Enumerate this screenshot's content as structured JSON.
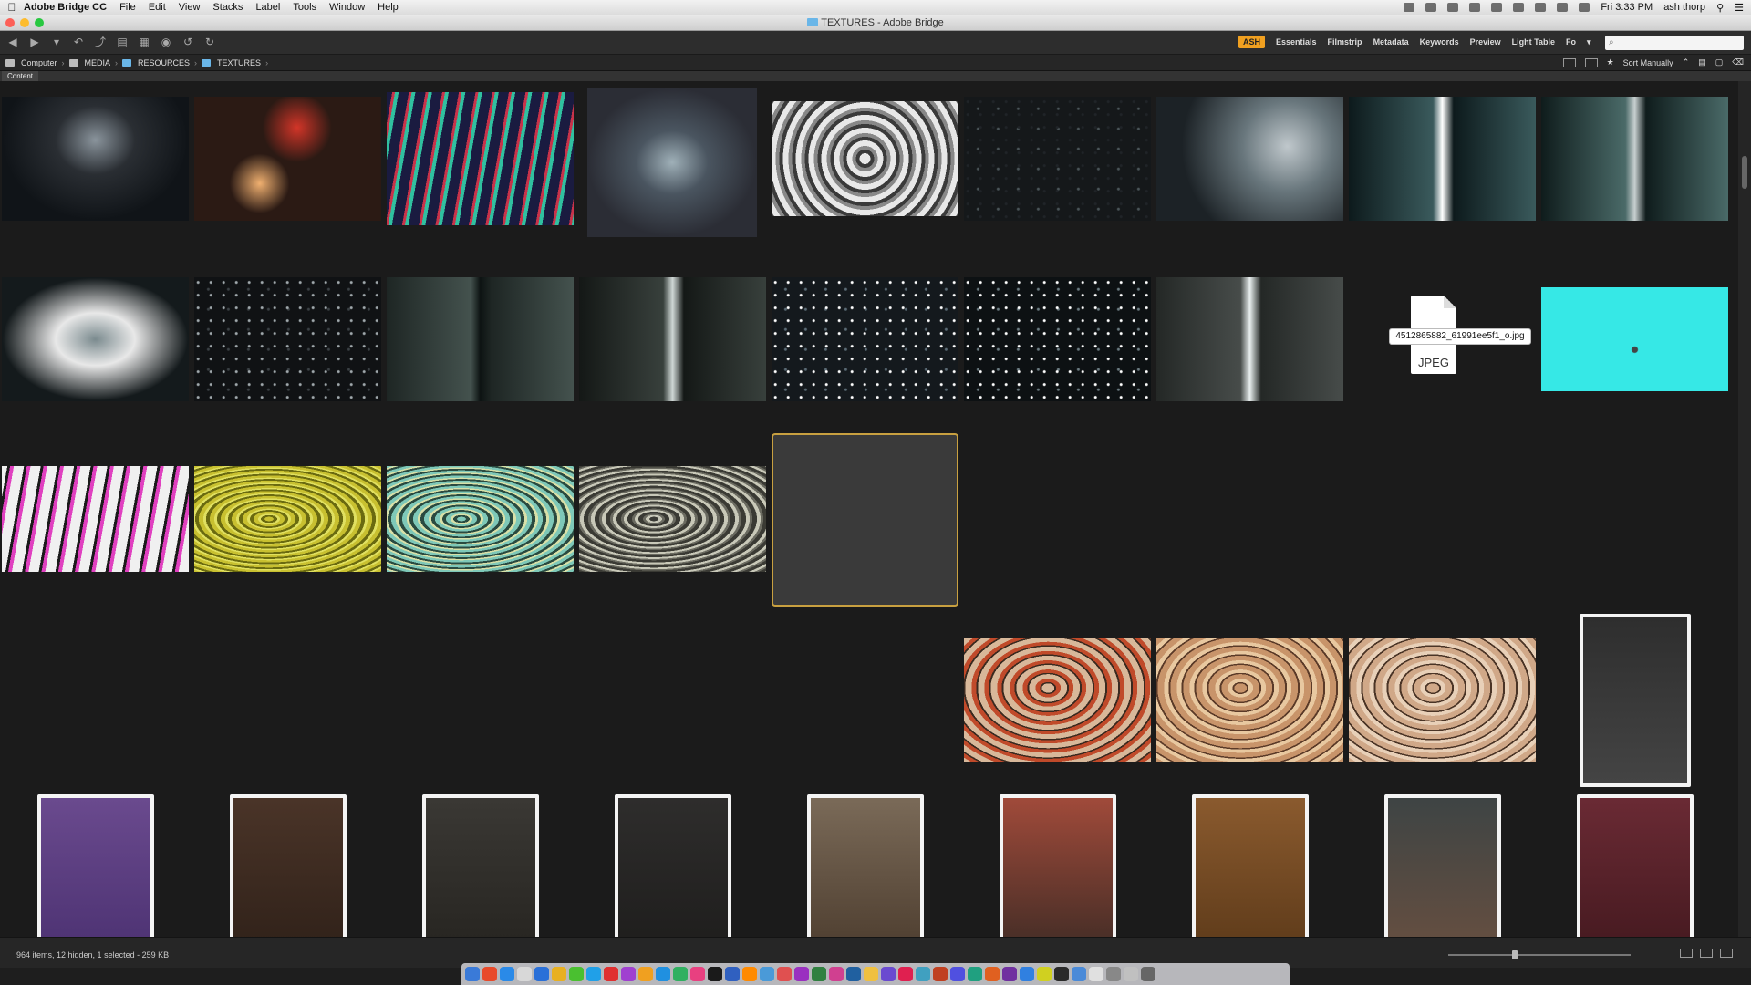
{
  "menubar": {
    "app_name": "Adobe Bridge CC",
    "items": [
      "File",
      "Edit",
      "View",
      "Stacks",
      "Label",
      "Tools",
      "Window",
      "Help"
    ],
    "clock": "Fri 3:33 PM",
    "user": "ash thorp"
  },
  "window": {
    "title": "TEXTURES - Adobe Bridge"
  },
  "toolbar": {
    "workspaces": [
      "ASH",
      "Essentials",
      "Filmstrip",
      "Metadata",
      "Keywords",
      "Preview",
      "Light Table",
      "Fo"
    ],
    "active_workspace": "ASH",
    "search_placeholder": "⌕"
  },
  "pathbar": {
    "crumbs": [
      "Computer",
      "MEDIA",
      "RESOURCES",
      "TEXTURES"
    ],
    "sort_label": "Sort Manually"
  },
  "panel": {
    "tab": "Content"
  },
  "file_tooltip": {
    "filename": "4512865882_61991ee5f1_o.jpg",
    "ext": "JPEG"
  },
  "status": {
    "text": "964 items, 12 hidden, 1 selected - 259 KB"
  },
  "thumbnails": [
    {
      "colors": [
        "#101418",
        "#8a949c",
        "#2a2e33"
      ],
      "kind": "corridor"
    },
    {
      "colors": [
        "#2b1a14",
        "#d23528",
        "#f0b070"
      ],
      "kind": "warm-blur"
    },
    {
      "colors": [
        "#1a1b40",
        "#c8334a",
        "#30c0a0"
      ],
      "kind": "glitch"
    },
    {
      "colors": [
        "#2b2d35",
        "#9fb0b8",
        "#4a5560"
      ],
      "kind": "glass"
    },
    {
      "colors": [
        "#e8e8e8",
        "#3a3a3a",
        "#888888"
      ],
      "kind": "spiral"
    },
    {
      "colors": [
        "#15181a",
        "#4a5458",
        "#202428"
      ],
      "kind": "dust"
    },
    {
      "colors": [
        "#1c2226",
        "#68767c",
        "#c0c8cc"
      ],
      "kind": "drops"
    },
    {
      "colors": [
        "#0d1a1c",
        "#3a5a5c",
        "#ffffff"
      ],
      "kind": "streak"
    },
    {
      "colors": [
        "#0f1c1c",
        "#4a6a68",
        "#c8d0d0"
      ],
      "kind": "streak"
    },
    {
      "colors": [
        "#141a1c",
        "#7a8a8e",
        "#e8e8e8"
      ],
      "kind": "glass"
    },
    {
      "colors": [
        "#101214",
        "#3a4044",
        "#a0a8ac"
      ],
      "kind": "dust"
    },
    {
      "colors": [
        "#1e2624",
        "#44524e",
        "#0d1312"
      ],
      "kind": "streak"
    },
    {
      "colors": [
        "#141816",
        "#38403c",
        "#d0d8d6"
      ],
      "kind": "streak"
    },
    {
      "colors": [
        "#14191d",
        "#5a6a74",
        "#ffffff"
      ],
      "kind": "dust"
    },
    {
      "colors": [
        "#0d1113",
        "#6a7a80",
        "#ffffff"
      ],
      "kind": "dust"
    },
    {
      "colors": [
        "#242826",
        "#474c4a",
        "#e8eeee"
      ],
      "kind": "streak"
    },
    {
      "colors": [
        "#1b1b1b",
        "#1b1b1b",
        "#1b1b1b"
      ],
      "kind": "file"
    },
    {
      "colors": [
        "#36e8e6",
        "#30d8d8",
        "#444444"
      ],
      "kind": "cyan"
    },
    {
      "colors": [
        "#f0f0f0",
        "#1a1a1a",
        "#e040c0"
      ],
      "kind": "glitch"
    },
    {
      "colors": [
        "#c8c030",
        "#6a6a10",
        "#e0e060"
      ],
      "kind": "waves"
    },
    {
      "colors": [
        "#7ec8b8",
        "#2a4a40",
        "#d8e0a8"
      ],
      "kind": "waves"
    },
    {
      "colors": [
        "#3a3a34",
        "#c8c8b8",
        "#6a6a60"
      ],
      "kind": "waves"
    },
    {
      "colors": [
        "#1e1c2a",
        "#c890a8",
        "#3a3450"
      ],
      "kind": "face"
    },
    {
      "colors": [
        "#161420",
        "#c06a9a",
        "#4a3a70"
      ],
      "kind": "face"
    },
    {
      "colors": [
        "#1c1a30",
        "#7a6aa8",
        "#2a2448"
      ],
      "kind": "face"
    },
    {
      "colors": [
        "#181620",
        "#c89aa8",
        "#4a3a5a"
      ],
      "kind": "face"
    },
    {
      "colors": [
        "#161428",
        "#d04a9a",
        "#3a3a8a"
      ],
      "kind": "face"
    },
    {
      "colors": [
        "#1e1c28",
        "#c890b0",
        "#3a3448"
      ],
      "kind": "face"
    },
    {
      "colors": [
        "#1a1a2c",
        "#e8a0c0",
        "#3a3458"
      ],
      "kind": "face"
    },
    {
      "colors": [
        "#161422",
        "#b080c0",
        "#2a2444"
      ],
      "kind": "face"
    },
    {
      "colors": [
        "#161420",
        "#c09ab0",
        "#3a3050"
      ],
      "kind": "face"
    },
    {
      "colors": [
        "#1a1618",
        "#b08890",
        "#3a2c34"
      ],
      "kind": "face"
    },
    {
      "colors": [
        "#d8b89a",
        "#3a2a20",
        "#c04a2a"
      ],
      "kind": "marble"
    },
    {
      "colors": [
        "#c8946a",
        "#5a3a28",
        "#e8c8a0"
      ],
      "kind": "marble"
    },
    {
      "colors": [
        "#d0a888",
        "#4a3426",
        "#e8d0b8"
      ],
      "kind": "marble"
    },
    {
      "colors": [
        "#f4f4f4",
        "#2e2e2e",
        "#444444"
      ],
      "kind": "book"
    },
    {
      "colors": [
        "#f4f4f4",
        "#6a4a8e",
        "#4a3070"
      ],
      "kind": "book"
    },
    {
      "colors": [
        "#f4f4f4",
        "#4a3428",
        "#2e2018"
      ],
      "kind": "book"
    },
    {
      "colors": [
        "#f4f4f4",
        "#3a3834",
        "#25231f"
      ],
      "kind": "book"
    },
    {
      "colors": [
        "#f4f4f4",
        "#2e2d2c",
        "#1d1c1b"
      ],
      "kind": "book"
    },
    {
      "colors": [
        "#f4f4f4",
        "#7a6a58",
        "#4a3a2c"
      ],
      "kind": "book"
    },
    {
      "colors": [
        "#f4f4f4",
        "#a04a3a",
        "#3a2a24"
      ],
      "kind": "book"
    },
    {
      "colors": [
        "#f4f4f4",
        "#8a5a2e",
        "#5a3818"
      ],
      "kind": "book"
    },
    {
      "colors": [
        "#f4f4f4",
        "#3e4444",
        "#6a5040"
      ],
      "kind": "book"
    },
    {
      "colors": [
        "#f4f4f4",
        "#6a2a34",
        "#42181e"
      ],
      "kind": "book"
    }
  ],
  "selected_index": 22,
  "dock_colors": [
    "#3a7ad8",
    "#e84a2a",
    "#2a8ae8",
    "#d8d8d8",
    "#2a70d8",
    "#e8b020",
    "#4ac030",
    "#20a0e8",
    "#e03030",
    "#a040d0",
    "#f0a020",
    "#2090e0",
    "#30b060",
    "#e84080",
    "#1a1a1a",
    "#3060c0",
    "#ff8a00",
    "#4a9ad8",
    "#e05050",
    "#9a30c0",
    "#308040",
    "#d04090",
    "#2060a0",
    "#f0c040",
    "#6a4ad0",
    "#e02050",
    "#40a0c0",
    "#c04020",
    "#5050e0",
    "#20a080",
    "#e06020",
    "#7030a0",
    "#3080e0",
    "#d0d020",
    "#2a2a2a",
    "#4a8ad8",
    "#e0e0e0",
    "#888888",
    "#c0c0c0",
    "#666666"
  ]
}
